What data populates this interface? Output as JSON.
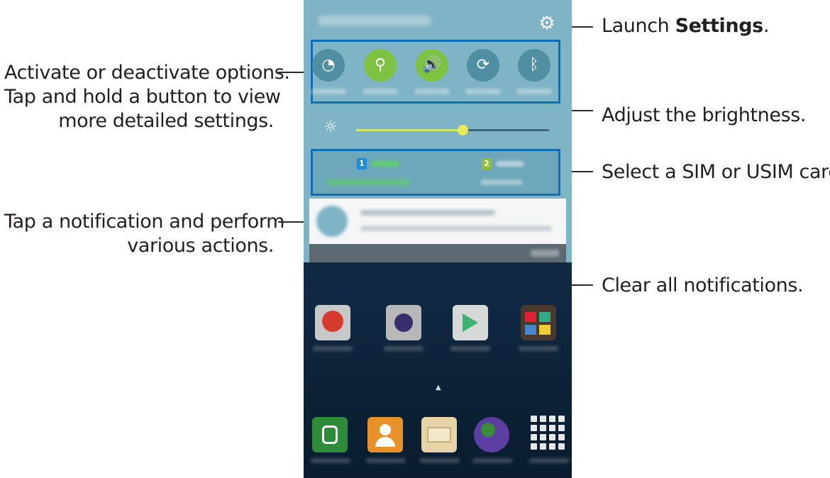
{
  "callouts": {
    "settings_prefix": "Launch ",
    "settings_bold": "Settings",
    "settings_suffix": ".",
    "options_line1": "Activate or deactivate options.",
    "options_line2": "Tap and hold a button to view",
    "options_line3": "more detailed settings.",
    "brightness": "Adjust the brightness.",
    "sim": "Select a SIM or USIM card.",
    "notification_line1": "Tap a notification and perform",
    "notification_line2": "various actions.",
    "clear": "Clear all notifications."
  },
  "quick_settings": [
    {
      "icon": "wifi-icon",
      "glyph": "◔",
      "on": false
    },
    {
      "icon": "location-icon",
      "glyph": "⚲",
      "on": true
    },
    {
      "icon": "sound-icon",
      "glyph": "🔊",
      "on": true
    },
    {
      "icon": "screen-rotation-icon",
      "glyph": "⟳",
      "on": false
    },
    {
      "icon": "bluetooth-icon",
      "glyph": "ᛒ",
      "on": false
    }
  ],
  "brightness_level": 0.55,
  "sim_cards": [
    {
      "badge": "1",
      "color": "#1f8ad6"
    },
    {
      "badge": "2",
      "color": "#8fbf3a"
    }
  ],
  "colors": {
    "panel": "#7fb3c6",
    "highlight_border": "#0f6fb4",
    "toggle_on": "#7fc242"
  },
  "glyphs": {
    "gear": "⚙",
    "sun": "☼",
    "home_indicator": "▲"
  }
}
